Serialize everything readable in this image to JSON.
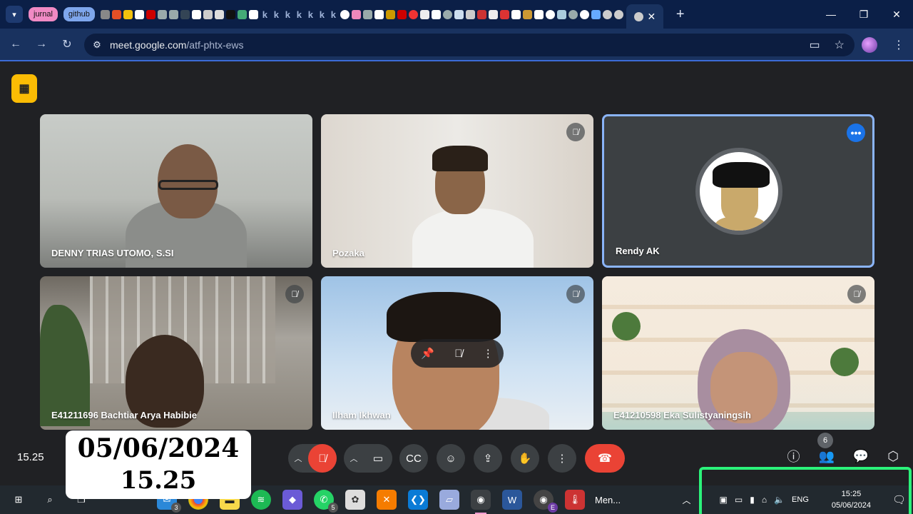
{
  "browser": {
    "tab_groups": [
      "jurnal",
      "github"
    ],
    "url_host": "meet.google.com",
    "url_path": "/atf-phtx-ews"
  },
  "meet": {
    "participants": [
      {
        "name": "DENNY TRIAS UTOMO, S.SI",
        "muted": false
      },
      {
        "name": "Pozaka",
        "muted": true
      },
      {
        "name": "Rendy AK",
        "muted": false
      },
      {
        "name": "E41211696 Bachtiar Arya Habibie",
        "muted": true
      },
      {
        "name": "Ilham Ikhwan",
        "muted": true
      },
      {
        "name": "E41210598 Eka Sulistyaningsih",
        "muted": true
      }
    ],
    "clock": "15.25",
    "people_count": "6"
  },
  "stamp": {
    "date": "05/06/2024",
    "time": "15.25"
  },
  "taskbar": {
    "mail_badge": "3",
    "whatsapp_badge": "5",
    "chrome_profile_badge": "E",
    "app_label": "Men...",
    "language": "ENG",
    "time": "15:25",
    "date": "05/06/2024"
  },
  "colors": {
    "accent": "#8ab4f8",
    "end_call": "#ea4335",
    "highlight_box": "#2bf27a"
  }
}
